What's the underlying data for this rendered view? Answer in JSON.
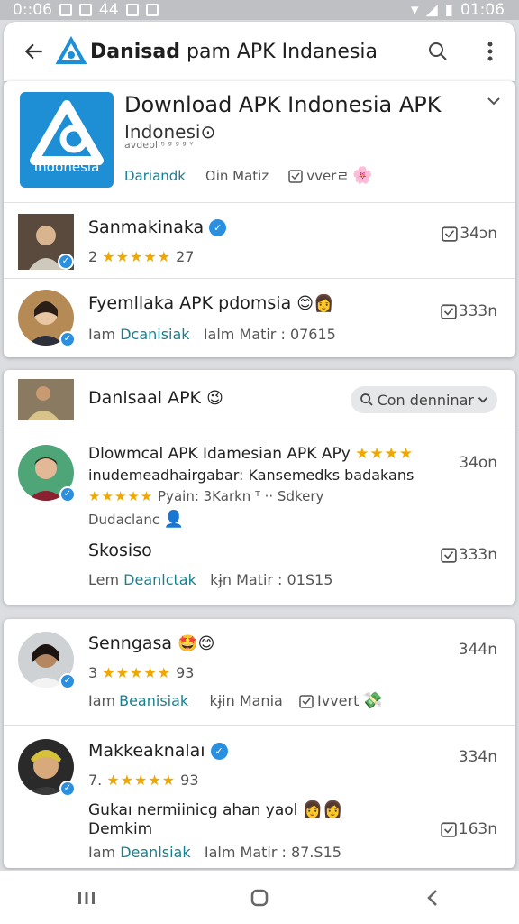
{
  "status_bar": {
    "time_left": "0::06",
    "notif_text": "44",
    "time_right": "01:06"
  },
  "app_bar": {
    "title_bold": "Danisad",
    "title_rest": " pam APK Indanesia"
  },
  "header_card": {
    "logo_text": "Indonesia",
    "title": "Download APK Indonesia APK",
    "subtitle": "Indonesi⊙",
    "tiny": "avdebl  ᵑ ᵍ  ᵍ ᵍ  ᵛ",
    "action1": "Dariandk",
    "action2": "Ɑin Matiz",
    "action3": "vverㄹ"
  },
  "card1_rows": [
    {
      "name": "Sanmakinaka",
      "count": "2",
      "rating_num": "27",
      "time": "34ɔn"
    },
    {
      "name": "Fyemllaka APK pdomsia",
      "label_a": "Iam",
      "label_b": "Dcanisiak",
      "label_c": "Ialm Matir : 07615",
      "time": "333n"
    }
  ],
  "card2_header": {
    "title": "Danlsaal APK",
    "chip": "Con denninar"
  },
  "card2_row": {
    "line1": "Dlowmcal APK Idamesian APK APy",
    "line2": "inudemeadhairgabar: Kansemedks badakans",
    "line3": "Pyain: 3Karkn  ᵀ  ··  Sdkery",
    "line4": "Dudaclanc",
    "heading": "Skosiso",
    "time_top": "34on",
    "label_a": "Lem",
    "label_b": "Deanlctak",
    "label_c": "kɉn Matir : 01S15",
    "time": "333n"
  },
  "card3_rows": [
    {
      "name": "Senngasa",
      "count": "3",
      "rating_num": "93",
      "label_a": "Iam",
      "label_b": "Beanisiak",
      "label_c": "kɉin Mania",
      "label_d": "Ivvert",
      "time": "344n"
    },
    {
      "name": "Makkeaknalaı",
      "count": "7.",
      "rating_num": "93",
      "line_a": "Gukaı nermiinicg ahan yaol",
      "line_b": "Demkim",
      "label_a": "Iam",
      "label_b": "Deanlsiak",
      "label_c": "Ialm Matir : 87.S15",
      "time_top": "334n",
      "time": "163n"
    }
  ],
  "colors": {
    "accent": "#17808f",
    "verified": "#2b8fe0",
    "star": "#f0a800",
    "logo_bg": "#1e8fd4"
  },
  "icons": [
    "back-arrow-icon",
    "search-icon",
    "more-vert-icon",
    "chevron-down-icon",
    "calendar-icon",
    "verified-icon",
    "recents-icon",
    "home-icon",
    "nav-back-icon"
  ]
}
